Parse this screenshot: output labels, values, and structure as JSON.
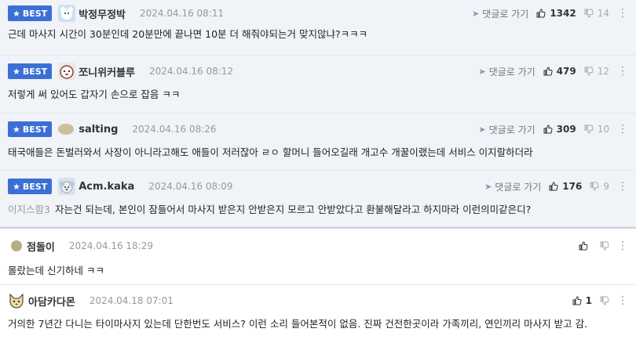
{
  "comments": [
    {
      "best": true,
      "badge": "BEST",
      "nick": "박정무정박",
      "date": "2024.04.16 08:11",
      "reply": "댓글로 가기",
      "likes": "1342",
      "dislikes": "14",
      "text": "근데 마사지 시간이 30분인데 20분만에 끝나면 10분 더 해줘야되는거 맞지않냐?ㅋㅋㅋ",
      "avatar": "bear-avatar"
    },
    {
      "best": true,
      "badge": "BEST",
      "nick": "쪼니위커블루",
      "date": "2024.04.16 08:12",
      "reply": "댓글로 가기",
      "likes": "479",
      "dislikes": "12",
      "text": "저렇게 써 있어도 갑자기 손으로 잡음 ㅋㅋ",
      "avatar": "dog-avatar"
    },
    {
      "best": true,
      "badge": "BEST",
      "nick": "salting",
      "date": "2024.04.16 08:26",
      "reply": "댓글로 가기",
      "likes": "309",
      "dislikes": "10",
      "text": "태국애들은 돈벌러와서 사장이 아니라고해도 애들이 저러잖아 ㄹㅇ 할머니 들어오길래 개고수 개꿀이랬는데 서비스 이지랄하더라",
      "avatar": "stone-avatar"
    },
    {
      "best": true,
      "badge": "BEST",
      "nick": "Acm.kaka",
      "date": "2024.04.16 08:09",
      "reply": "댓글로 가기",
      "likes": "176",
      "dislikes": "9",
      "mention": "이지스함3",
      "text": "자는건 되는데, 본인이 잠들어서 마사지 받은지 안받은지 모르고 안받았다고 환불해달라고 하지마라 이런의미같은디?",
      "avatar": "koala-avatar"
    },
    {
      "best": false,
      "nick": "점돌이",
      "date": "2024.04.16 18:29",
      "likes": "",
      "text": "몰랐는데 신기하네 ㅋㅋ",
      "avatar": "stone-avatar"
    },
    {
      "best": false,
      "nick": "아담카다몬",
      "date": "2024.04.18 07:01",
      "likes": "1",
      "text": "거의한 7년간 다니는 타이마사지 있는데 단한번도 서비스? 이런 소리 들어본적이 없음. 진짜 건전한곳이라 가족끼리, 연인끼리 마사지 받고 감.",
      "avatar": "fox-avatar"
    }
  ],
  "icons": {
    "star": "★",
    "reply": "➤",
    "more": "⋮"
  },
  "colors": {
    "best_badge": "#3b6fd6",
    "best_bg": "#f0f3f8"
  }
}
